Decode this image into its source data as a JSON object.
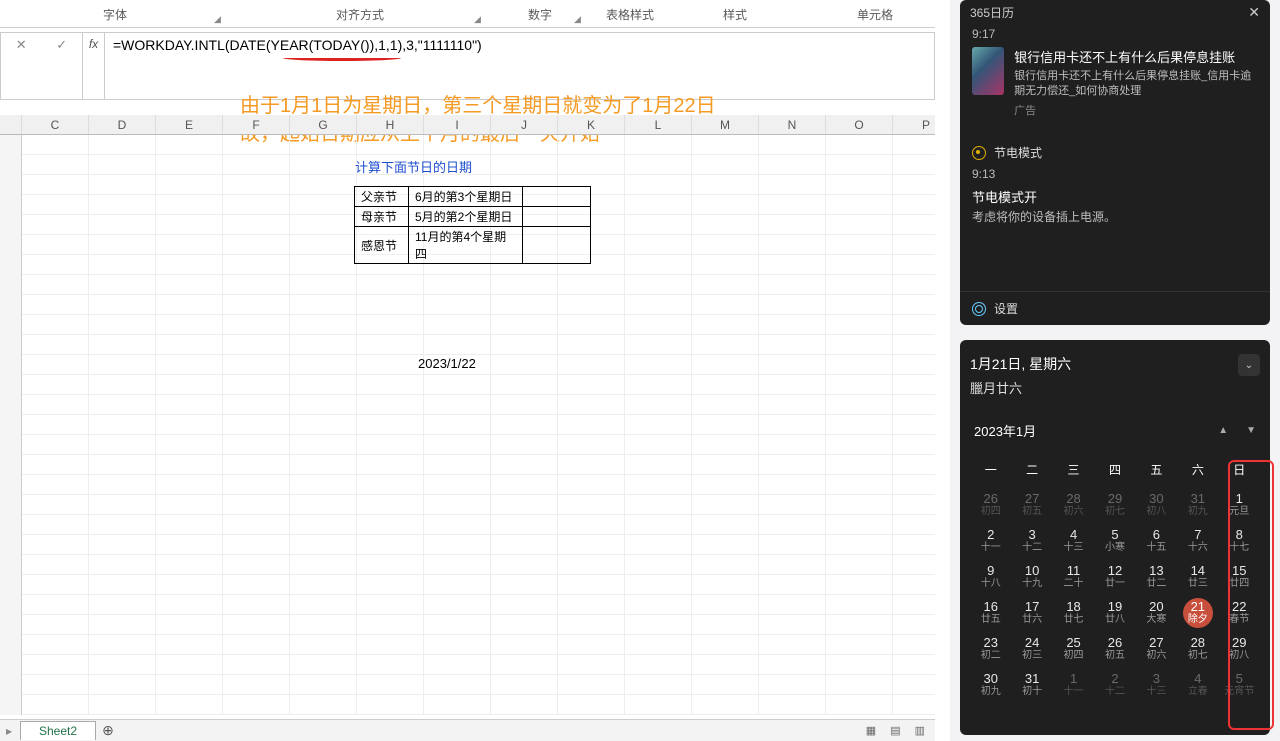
{
  "ribbon": {
    "groups": [
      "字体",
      "对齐方式",
      "数字",
      "表格样式",
      "样式",
      "单元格"
    ]
  },
  "formula_bar": {
    "cancel": "✕",
    "enter": "✓",
    "fx": "fx",
    "formula": "=WORKDAY.INTL(DATE(YEAR(TODAY()),1,1),3,\"1111110\")"
  },
  "annotation": {
    "line1": "由于1月1日为星期日，第三个星期日就变为了1月22日",
    "line2": "故，起始日期应从上个月的最后一天开始"
  },
  "columns": [
    "C",
    "D",
    "E",
    "F",
    "G",
    "H",
    "I",
    "J",
    "K",
    "L",
    "M",
    "N",
    "O",
    "P"
  ],
  "worksheet": {
    "title": "计算下面节日的日期",
    "rows": [
      {
        "name": "父亲节",
        "rule": "6月的第3个星期日",
        "val": ""
      },
      {
        "name": "母亲节",
        "rule": "5月的第2个星期日",
        "val": ""
      },
      {
        "name": "感恩节",
        "rule": "11月的第4个星期四",
        "val": ""
      }
    ],
    "result": "2023/1/22"
  },
  "sheet_tabs": {
    "active": "Sheet2",
    "add": "⊕"
  },
  "notifications": {
    "app_title": "365日历",
    "time1": "9:17",
    "headline": "银行信用卡还不上有什么后果停息挂账",
    "subline": "银行信用卡还不上有什么后果停息挂账_信用卡逾期无力偿还_如何协商处理",
    "ad_label": "广告",
    "power_label": "节电模式",
    "time2": "9:13",
    "power_title": "节电模式开",
    "power_sub": "考虑将你的设备插上电源。",
    "settings": "设置"
  },
  "calendar": {
    "date_main": "1月21日, 星期六",
    "date_sub": "臘月廿六",
    "month": "2023年1月",
    "dow": [
      "一",
      "二",
      "三",
      "四",
      "五",
      "六",
      "日"
    ],
    "weeks": [
      [
        {
          "d": "26",
          "l": "初四",
          "dim": true
        },
        {
          "d": "27",
          "l": "初五",
          "dim": true
        },
        {
          "d": "28",
          "l": "初六",
          "dim": true
        },
        {
          "d": "29",
          "l": "初七",
          "dim": true
        },
        {
          "d": "30",
          "l": "初八",
          "dim": true
        },
        {
          "d": "31",
          "l": "初九",
          "dim": true
        },
        {
          "d": "1",
          "l": "元旦"
        }
      ],
      [
        {
          "d": "2",
          "l": "十一"
        },
        {
          "d": "3",
          "l": "十二"
        },
        {
          "d": "4",
          "l": "十三"
        },
        {
          "d": "5",
          "l": "小寒"
        },
        {
          "d": "6",
          "l": "十五"
        },
        {
          "d": "7",
          "l": "十六"
        },
        {
          "d": "8",
          "l": "十七"
        }
      ],
      [
        {
          "d": "9",
          "l": "十八"
        },
        {
          "d": "10",
          "l": "十九"
        },
        {
          "d": "11",
          "l": "二十"
        },
        {
          "d": "12",
          "l": "廿一"
        },
        {
          "d": "13",
          "l": "廿二"
        },
        {
          "d": "14",
          "l": "廿三"
        },
        {
          "d": "15",
          "l": "廿四"
        }
      ],
      [
        {
          "d": "16",
          "l": "廿五"
        },
        {
          "d": "17",
          "l": "廿六"
        },
        {
          "d": "18",
          "l": "廿七"
        },
        {
          "d": "19",
          "l": "廿八"
        },
        {
          "d": "20",
          "l": "大寒"
        },
        {
          "d": "21",
          "l": "除夕",
          "today": true
        },
        {
          "d": "22",
          "l": "春节"
        }
      ],
      [
        {
          "d": "23",
          "l": "初二"
        },
        {
          "d": "24",
          "l": "初三"
        },
        {
          "d": "25",
          "l": "初四"
        },
        {
          "d": "26",
          "l": "初五"
        },
        {
          "d": "27",
          "l": "初六"
        },
        {
          "d": "28",
          "l": "初七"
        },
        {
          "d": "29",
          "l": "初八"
        }
      ],
      [
        {
          "d": "30",
          "l": "初九"
        },
        {
          "d": "31",
          "l": "初十"
        },
        {
          "d": "1",
          "l": "十一",
          "dim": true
        },
        {
          "d": "2",
          "l": "十二",
          "dim": true
        },
        {
          "d": "3",
          "l": "十三",
          "dim": true
        },
        {
          "d": "4",
          "l": "立春",
          "dim": true
        },
        {
          "d": "5",
          "l": "元宵节",
          "dim": true
        }
      ]
    ]
  }
}
